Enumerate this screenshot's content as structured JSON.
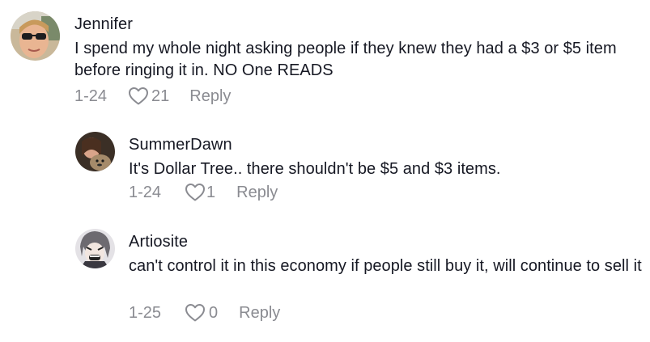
{
  "comments": [
    {
      "username": "Jennifer",
      "text": "I spend my whole night asking people if they knew they had a $3 or $5 item before ringing it in. NO One READS",
      "date": "1-24",
      "likes": "21",
      "reply_label": "Reply",
      "like_icon": "heart-outline-icon"
    },
    {
      "username": "SummerDawn",
      "text": "It's Dollar Tree.. there shouldn't be $5 and $3 items.",
      "date": "1-24",
      "likes": "1",
      "reply_label": "Reply",
      "like_icon": "heart-outline-icon"
    },
    {
      "username": "Artiosite",
      "text": "can't control it in this economy if people still buy it, will continue to sell it",
      "date": "1-25",
      "likes": "0",
      "reply_label": "Reply",
      "like_icon": "heart-outline-icon"
    }
  ],
  "colors": {
    "username": "#161823",
    "text": "#161823",
    "meta": "#8a8b91"
  }
}
